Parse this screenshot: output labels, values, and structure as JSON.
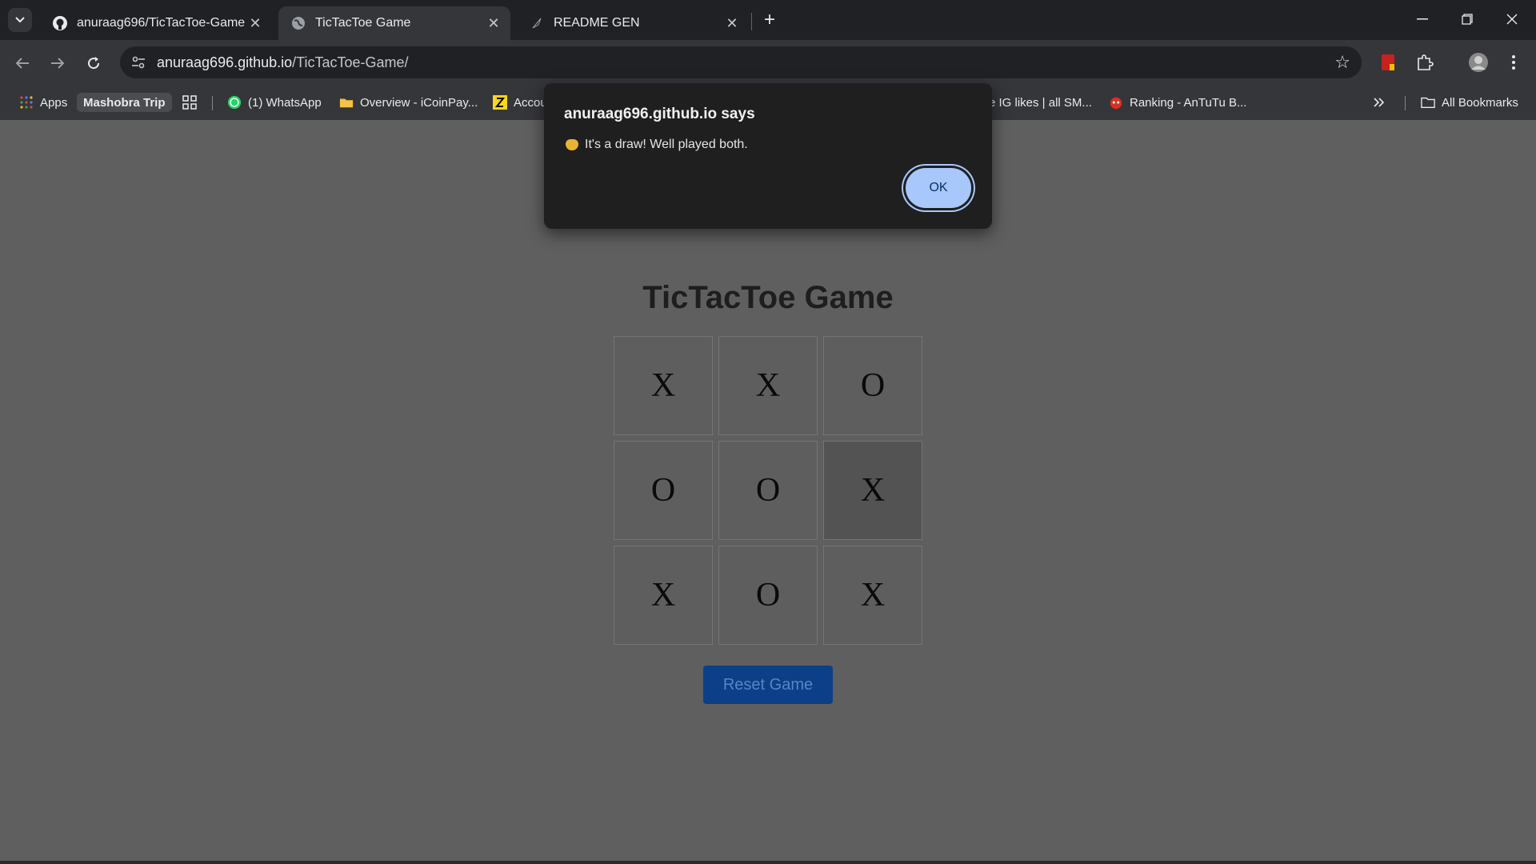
{
  "browser": {
    "tabs": [
      {
        "title": "anuraag696/TicTacToe-Game",
        "icon": "github-icon",
        "active": false
      },
      {
        "title": "TicTacToe Game",
        "icon": "globe-icon",
        "active": true
      },
      {
        "title": "README GEN",
        "icon": "feather-icon",
        "active": false
      }
    ],
    "url_host": "anuraag696.github.io",
    "url_path": "/TicTacToe-Game/",
    "bookmarks": [
      {
        "label": "Apps",
        "icon": "apps-grid-icon"
      },
      {
        "label": "Mashobra Trip",
        "icon": ""
      },
      {
        "label": "",
        "icon": "tab-groups-icon"
      },
      {
        "label": "(1) WhatsApp",
        "icon": "whatsapp-icon"
      },
      {
        "label": "Overview - iCoinPay...",
        "icon": "folder-icon"
      },
      {
        "label": "Accou",
        "icon": "yellow-badge-icon"
      },
      {
        "label": "e IG likes | all SM...",
        "icon": ""
      },
      {
        "label": "Ranking - AnTuTu B...",
        "icon": "antutu-icon"
      }
    ],
    "all_bookmarks_label": "All Bookmarks"
  },
  "game": {
    "title": "TicTacToe Game",
    "board": [
      "X",
      "X",
      "O",
      "O",
      "O",
      "X",
      "X",
      "O",
      "X"
    ],
    "reset_label": "Reset Game"
  },
  "dialog": {
    "origin": "anuraag696.github.io says",
    "message": "It's a draw! Well played both.",
    "ok_label": "OK"
  }
}
